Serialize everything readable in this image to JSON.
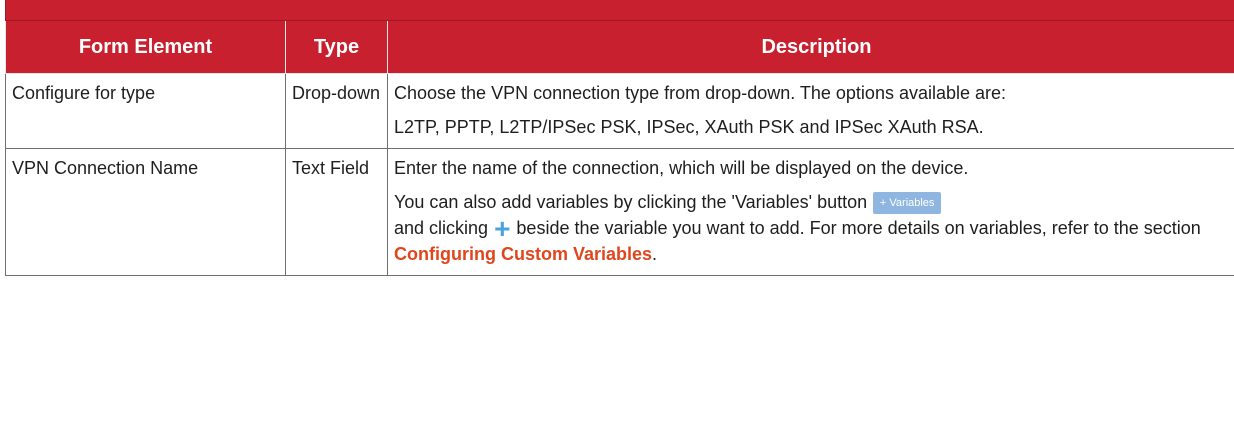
{
  "table": {
    "title": "",
    "headers": [
      "Form Element",
      "Type",
      "Description"
    ],
    "rows": [
      {
        "element": "Configure for type",
        "type": "Drop-down",
        "paragraphs": [
          "Choose the VPN connection type from drop-down. The options available are:",
          "L2TP, PPTP, L2TP/IPSec PSK, IPSec, XAuth PSK and IPSec XAuth RSA."
        ]
      },
      {
        "element": "VPN Connection Name",
        "type": "Text Field",
        "paragraphs": [
          "Enter the name of the connection, which will be displayed on the device."
        ],
        "variables_text_1": "You can also add variables by clicking the 'Variables' button",
        "variables_button_label": "+ Variables",
        "variables_text_2": "and clicking",
        "variables_text_3": "beside the variable you want to add. For more details on variables, refer to the section",
        "link_text": "Configuring Custom Variables",
        "variables_text_4": "."
      }
    ]
  },
  "icons": {
    "plus": "plus-icon"
  },
  "colors": {
    "header_bg": "#c8202f",
    "link": "#e0461c",
    "plus_icon": "#4aa3df",
    "variables_button_bg": "#8fb6e0"
  }
}
